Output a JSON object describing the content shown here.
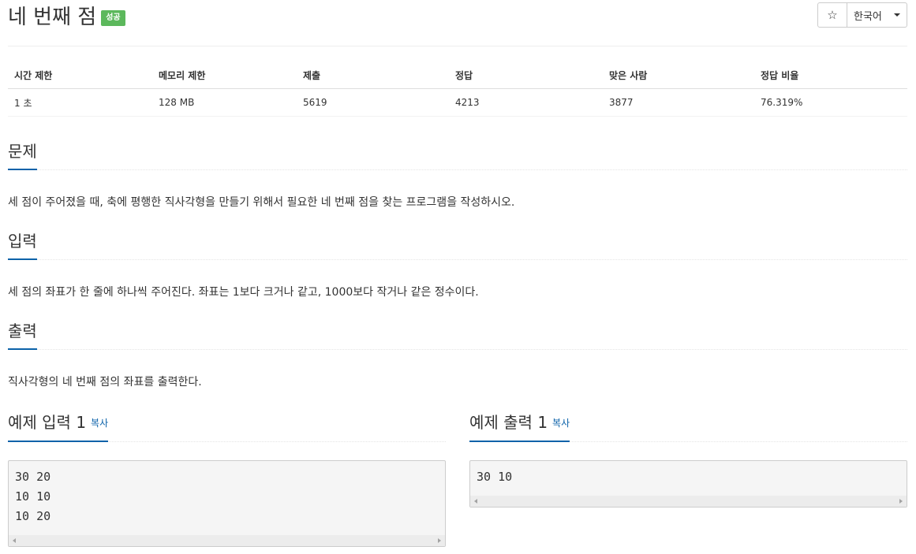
{
  "header": {
    "title": "네 번째 점",
    "badge": "성공",
    "star_icon": "☆",
    "language": "한국어"
  },
  "stats": {
    "headers": [
      "시간 제한",
      "메모리 제한",
      "제출",
      "정답",
      "맞은 사람",
      "정답 비율"
    ],
    "values": [
      "1 초",
      "128 MB",
      "5619",
      "4213",
      "3877",
      "76.319%"
    ]
  },
  "sections": {
    "problem": {
      "title": "문제",
      "text": "세 점이 주어졌을 때, 축에 평행한 직사각형을 만들기 위해서 필요한 네 번째 점을 찾는 프로그램을 작성하시오."
    },
    "input": {
      "title": "입력",
      "text": "세 점의 좌표가 한 줄에 하나씩 주어진다. 좌표는 1보다 크거나 같고, 1000보다 작거나 같은 정수이다."
    },
    "output": {
      "title": "출력",
      "text": "직사각형의 네 번째 점의 좌표를 출력한다."
    }
  },
  "examples": {
    "input": {
      "title": "예제 입력 1",
      "copy": "복사",
      "lines": [
        "30 20",
        "10 10",
        "10 20"
      ]
    },
    "output": {
      "title": "예제 출력 1",
      "copy": "복사",
      "lines": [
        "30 10"
      ]
    }
  },
  "colors": {
    "accent": "#0b62a9",
    "success": "#5cb85c"
  }
}
